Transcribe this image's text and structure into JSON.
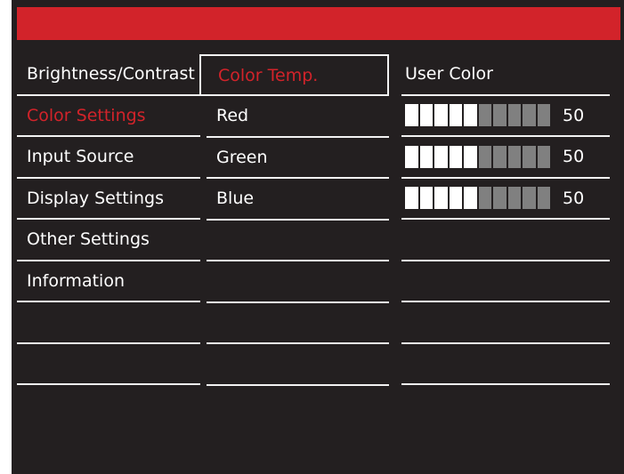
{
  "menu": [
    {
      "label": "Brightness/Contrast",
      "active": false
    },
    {
      "label": "Color Settings",
      "active": true
    },
    {
      "label": "Input Source",
      "active": false
    },
    {
      "label": "Display Settings",
      "active": false
    },
    {
      "label": "Other Settings",
      "active": false
    },
    {
      "label": "Information",
      "active": false
    },
    {
      "label": "",
      "active": false
    },
    {
      "label": "",
      "active": false
    }
  ],
  "submenu": [
    {
      "label": "Color Temp.",
      "active": true
    },
    {
      "label": "Red"
    },
    {
      "label": "Green"
    },
    {
      "label": "Blue"
    },
    {
      "label": ""
    },
    {
      "label": ""
    },
    {
      "label": ""
    },
    {
      "label": ""
    }
  ],
  "values": {
    "header": "User Color",
    "red": {
      "value": "50",
      "filled_segments": 5,
      "total_segments": 10
    },
    "green": {
      "value": "50",
      "filled_segments": 5,
      "total_segments": 10
    },
    "blue": {
      "value": "50",
      "filled_segments": 5,
      "total_segments": 10
    }
  },
  "colors": {
    "accent": "#d2232a",
    "background": "#231f20",
    "segment_on": "#ffffff",
    "segment_off": "#808080"
  }
}
